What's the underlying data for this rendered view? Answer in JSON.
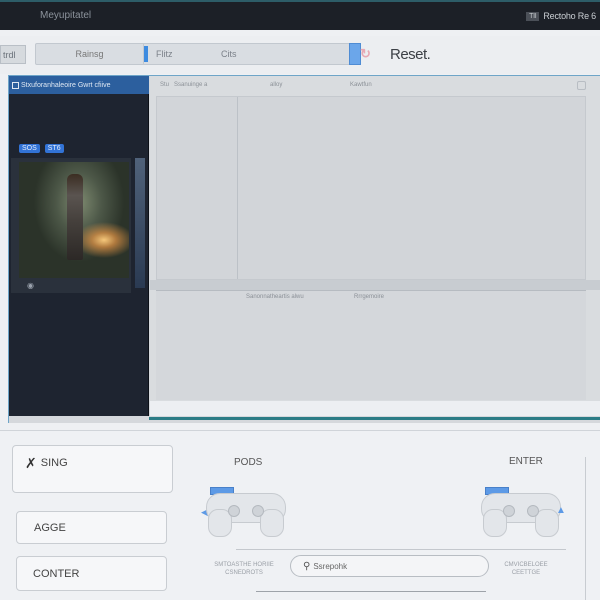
{
  "titlebar": {
    "title": "Meyupitatel",
    "right_badge": "TII",
    "right_title": "Rectoho Re 6"
  },
  "toolbar": {
    "left_tab": "trdl",
    "segment_1": "Rainsg",
    "segment_2": "Flitz",
    "segment_3": "Cits",
    "reset_label": "Reset."
  },
  "side_panel": {
    "header": "Stxuforanhaleoire Gwrt cfiive",
    "chip_1": "SOS",
    "chip_2": "ST6"
  },
  "main_pane": {
    "header_left": "Stu",
    "header_mid": "Ssanuinge a",
    "header_center": "alloy",
    "header_right": "Kawtfun",
    "bottom_header_1": "Sanonnatheartis alwu",
    "bottom_header_2": "Rrrgemoire"
  },
  "bottom": {
    "options": [
      "SING",
      "AGGE",
      "CONTER"
    ],
    "pods_label": "PODS",
    "enter_label": "ENTER",
    "caption_left": "SMTOASTHE HORIIE CSNEDROTS",
    "caption_right": "CMVICBELOEE CEETTGE",
    "search_value": "Ssrepohk"
  },
  "colors": {
    "accent": "#2c7c86",
    "selection_blue": "#3d8be0",
    "panel_dark": "#1e2430",
    "header_blue": "#2c5f9e"
  }
}
